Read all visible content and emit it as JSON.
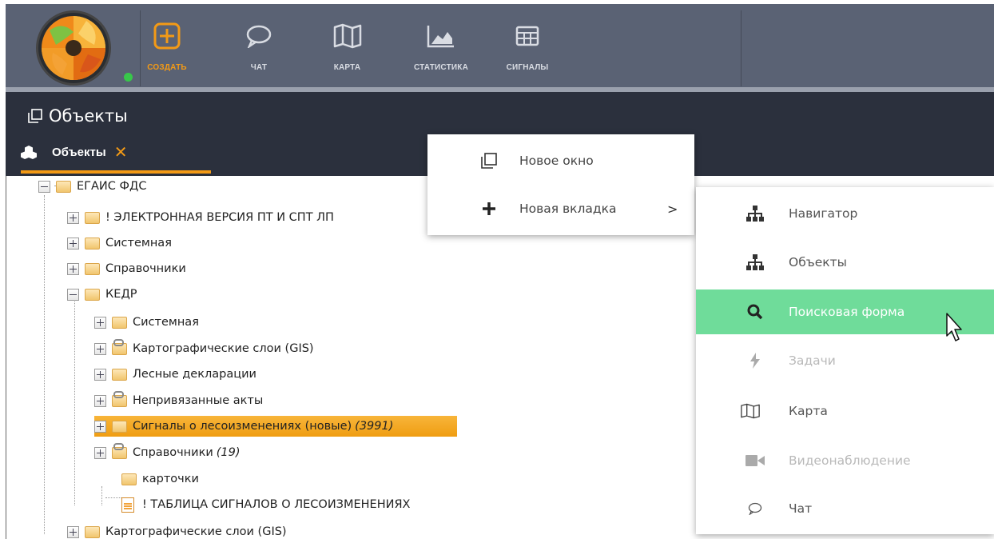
{
  "toolbar": {
    "items": [
      {
        "label": "СОЗДАТЬ",
        "icon": "plus-square-icon",
        "active": true
      },
      {
        "label": "ЧАТ",
        "icon": "chat-bubble-icon"
      },
      {
        "label": "КАРТА",
        "icon": "map-icon"
      },
      {
        "label": "СТАТИСТИКА",
        "icon": "area-chart-icon"
      },
      {
        "label": "СИГНАЛЫ",
        "icon": "table-grid-icon"
      }
    ],
    "accent": "#f39a16",
    "background": "#5a6274"
  },
  "panel": {
    "title": "Объекты",
    "tab": {
      "label": "Объекты",
      "close": "✕"
    }
  },
  "tree": {
    "nodes": [
      {
        "label": "ЕГАИС ФДС"
      },
      {
        "label": "! ЭЛЕКТРОННАЯ ВЕРСИЯ ПТ И СПТ ЛП"
      },
      {
        "label": "Системная"
      },
      {
        "label": "Справочники"
      },
      {
        "label": "КЕДР"
      },
      {
        "label": "Системная"
      },
      {
        "label": "Картографические слои (GIS)"
      },
      {
        "label": "Лесные декларации"
      },
      {
        "label": "Непривязанные акты"
      },
      {
        "label": "Сигналы о лесоизменениях (новые)",
        "count": "(3991)",
        "selected": true
      },
      {
        "label": "Справочники",
        "count": "(19)"
      },
      {
        "label": "карточки"
      },
      {
        "label": "! ТАБЛИЦА СИГНАЛОВ О ЛЕСОИЗМЕНЕНИЯХ"
      },
      {
        "label": "Картографические слои (GIS)"
      }
    ],
    "selected_color": "#f3a623"
  },
  "context_menu": {
    "items": [
      {
        "label": "Новое окно",
        "icon": "new-window-icon"
      },
      {
        "label": "Новая вкладка",
        "icon": "plus-icon",
        "arrow": ">"
      }
    ]
  },
  "submenu": {
    "items": [
      {
        "label": "Навигатор",
        "icon": "hierarchy-icon"
      },
      {
        "label": "Объекты",
        "icon": "hierarchy-icon"
      },
      {
        "label": "Поисковая форма",
        "icon": "search-icon",
        "highlighted": true
      },
      {
        "label": "Задачи",
        "icon": "lightning-icon",
        "disabled": true
      },
      {
        "label": "Карта",
        "icon": "map-icon"
      },
      {
        "label": "Видеонаблюдение",
        "icon": "video-camera-icon",
        "disabled": true
      },
      {
        "label": "Чат",
        "icon": "chat-bubble-icon"
      }
    ],
    "highlight_color": "#6fdc9a"
  }
}
